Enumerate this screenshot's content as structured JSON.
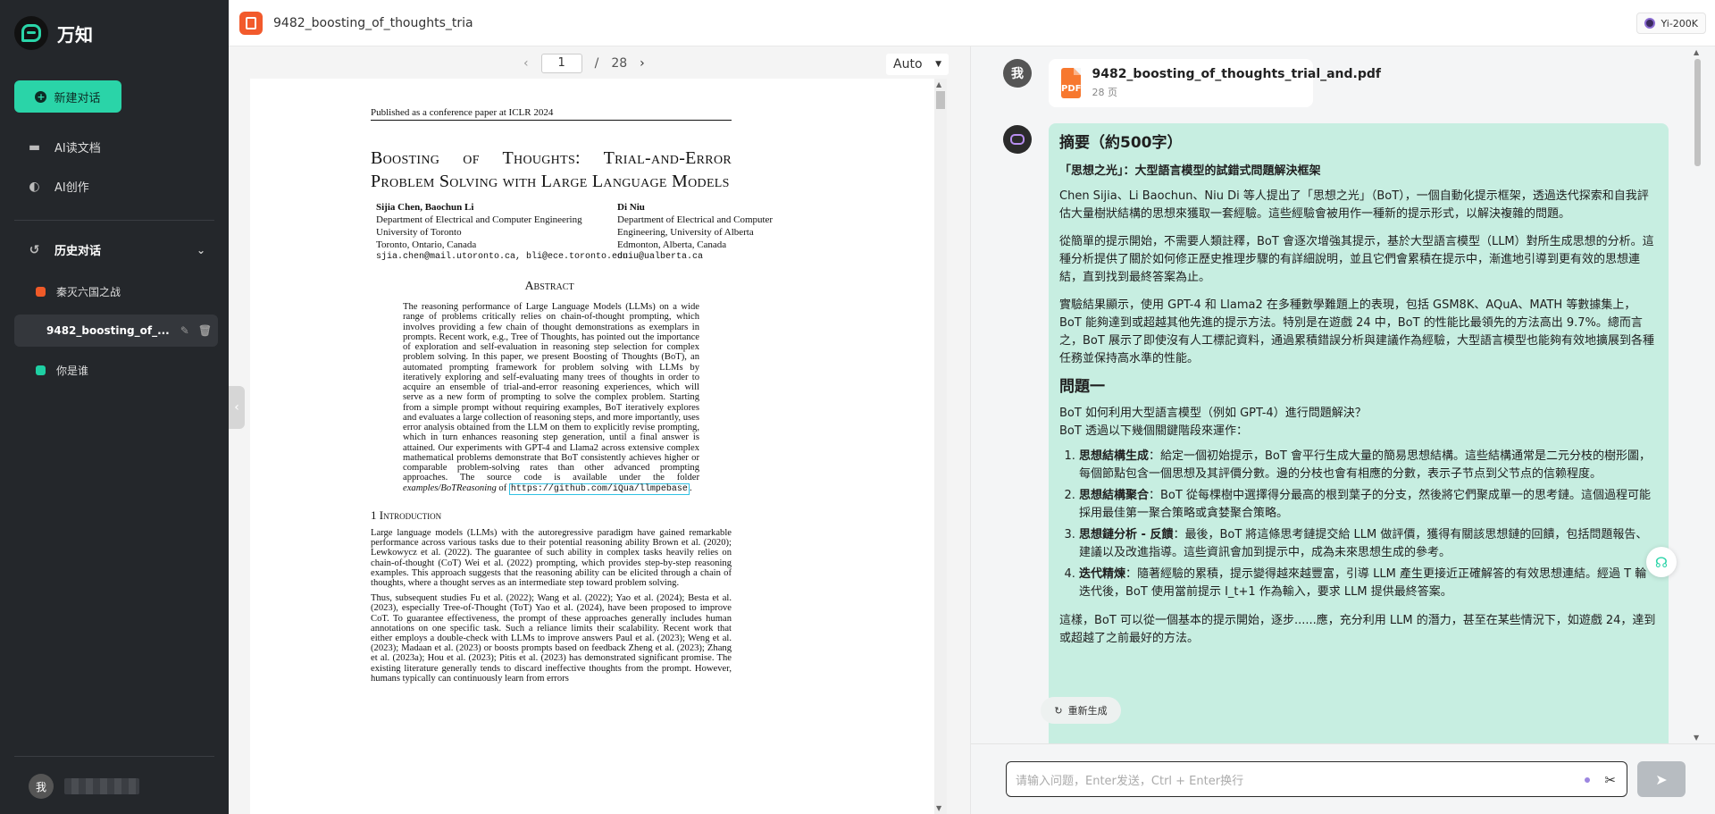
{
  "sidebar": {
    "brand": "万知",
    "new_chat": "新建对话",
    "nav": [
      {
        "label": "AI读文档",
        "icon": "folder-icon"
      },
      {
        "label": "AI创作",
        "icon": "bulb-icon"
      }
    ],
    "history_title": "历史对话",
    "history": [
      {
        "label": "秦灭六国之战",
        "color": "#f05a28"
      },
      {
        "label": "9482_boosting_of_...",
        "color": "#f05a28"
      },
      {
        "label": "你是谁",
        "color": "#1ecfa3"
      }
    ],
    "user_avatar": "我"
  },
  "topbar": {
    "file_title": "9482_boosting_of_thoughts_tria",
    "model": "Yi-200K"
  },
  "viewer": {
    "page": "1",
    "page_sep": "/",
    "total_pages": "28",
    "zoom": "Auto",
    "paper": {
      "conference": "Published as a conference paper at ICLR 2024",
      "title": "Boosting of Thoughts: Trial-and-Error Problem Solving with Large Language Models",
      "authors_left": [
        "Sijia Chen, Baochun Li",
        "Department of Electrical and Computer Engineering",
        "University of Toronto",
        "Toronto, Ontario, Canada",
        "sjia.chen@mail.utoronto.ca, bli@ece.toronto.edu"
      ],
      "authors_right": [
        "Di Niu",
        "Department of Electrical and Computer",
        "Engineering, University of Alberta",
        "Edmonton, Alberta, Canada",
        "dniu@ualberta.ca"
      ],
      "abstract_heading": "Abstract",
      "abstract": "The reasoning performance of Large Language Models (LLMs) on a wide range of problems critically relies on chain-of-thought prompting, which involves providing a few chain of thought demonstrations as exemplars in prompts. Recent work, e.g., Tree of Thoughts, has pointed out the importance of exploration and self-evaluation in reasoning step selection for complex problem solving. In this paper, we present Boosting of Thoughts (BoT), an automated prompting framework for problem solving with LLMs by iteratively exploring and self-evaluating many trees of thoughts in order to acquire an ensemble of trial-and-error reasoning experiences, which will serve as a new form of prompting to solve the complex problem. Starting from a simple prompt without requiring examples, BoT iteratively explores and evaluates a large collection of reasoning steps, and more importantly, uses error analysis obtained from the LLM on them to explicitly revise prompting, which in turn enhances reasoning step generation, until a final answer is attained. Our experiments with GPT-4 and Llama2 across extensive complex mathematical problems demonstrate that BoT consistently achieves higher or comparable problem-solving rates than other advanced prompting approaches. The source code is available under the folder",
      "abstract_folder": "examples/BoTReasoning",
      "abstract_of": "of",
      "abstract_link": "https://github.com/iQua/llmpebase",
      "intro_heading": "1   Introduction",
      "intro_p1": "Large language models (LLMs) with the autoregressive paradigm have gained remarkable performance across various tasks due to their potential reasoning ability Brown et al. (2020); Lewkowycz et al. (2022). The guarantee of such ability in complex tasks heavily relies on chain-of-thought (CoT) Wei et al. (2022) prompting, which provides step-by-step reasoning examples. This approach suggests that the reasoning ability can be elicited through a chain of thoughts, where a thought serves as an intermediate step toward problem solving.",
      "intro_p2": "Thus, subsequent studies Fu et al. (2022); Wang et al. (2022); Yao et al. (2024); Besta et al. (2023), especially Tree-of-Thought (ToT) Yao et al. (2024), have been proposed to improve CoT. To guarantee effectiveness, the prompt of these approaches generally includes human annotations on one specific task. Such a reliance limits their scalability. Recent work that either employs a double-check with LLMs to improve answers Paul et al. (2023); Weng et al. (2023); Madaan et al. (2023) or boosts prompts based on feedback Zheng et al. (2023); Zhang et al. (2023a); Hou et al. (2023); Pitis et al. (2023) has demonstrated significant promise. The existing literature generally tends to discard ineffective thoughts from the prompt. However, humans typically can continuously learn from errors"
    }
  },
  "chat": {
    "me": "我",
    "file_card": {
      "name": "9482_boosting_of_thoughts_trial_and.pdf",
      "pages": "28 页",
      "icon_text": "PDF"
    },
    "answer": {
      "title": "摘要（約500字）",
      "subtitle": "「思想之光」：大型語言模型的試錯式問題解決框架",
      "p1": "Chen Sijia、Li Baochun、Niu Di 等人提出了「思想之光」（BoT），一個自動化提示框架，透過迭代探索和自我評估大量樹狀結構的思想來獲取一套經驗。這些經驗會被用作一種新的提示形式，以解決複雜的問題。",
      "p2": "從簡單的提示開始，不需要人類註釋，BoT 會逐次增強其提示，基於大型語言模型（LLM）對所生成思想的分析。這種分析提供了關於如何修正歷史推理步驟的有詳細說明，並且它們會累積在提示中，漸進地引導到更有效的思想連結，直到找到最終答案為止。",
      "p3": "實驗結果顯示，使用 GPT-4 和 Llama2 在多種數學難題上的表現，包括 GSM8K、AQuA、MATH 等數據集上，BoT 能夠達到或超越其他先進的提示方法。特別是在遊戲 24 中，BoT 的性能比最領先的方法高出 9.7%。總而言之，BoT 展示了即使沒有人工標記資料，通過累積錯誤分析與建議作為經驗，大型語言模型也能夠有效地擴展到各種任務並保持高水準的性能。",
      "q1": "問題一",
      "q1_line1": "BoT 如何利用大型語言模型（例如 GPT-4）進行問題解決？",
      "q1_line2": "BoT 透過以下幾個關鍵階段來運作：",
      "steps": [
        {
          "head": "思想結構生成",
          "text": "：給定一個初始提示，BoT 會平行生成大量的簡易思想結構。這些結構通常是二元分枝的樹形圖，每個節點包含一個思想及其評價分數。邊的分枝也會有相應的分數，表示子节点到父节点的信赖程度。"
        },
        {
          "head": "思想結構聚合",
          "text": "：BoT 從每棵樹中選擇得分最高的根到葉子的分支，然後將它們聚成單一的思考鏈。這個過程可能採用最佳第一聚合策略或貪婪聚合策略。"
        },
        {
          "head": "思想鏈分析 - 反饋",
          "text": "：最後，BoT 將這條思考鏈提交給 LLM 做評價，獲得有關該思想鏈的回饋，包括問題報告、建議以及改進指導。這些資訊會加到提示中，成為未來思想生成的參考。"
        },
        {
          "head": "迭代精煉",
          "text": "：隨著經驗的累積，提示變得越來越豐富，引導 LLM 產生更接近正確解答的有效思想連結。經過 T 輪迭代後，BoT 使用當前提示 I_t+1 作為輸入，要求 LLM 提供最終答案。"
        }
      ],
      "p4": "這樣，BoT 可以從一個基本的提示開始，逐步......應，充分利用 LLM 的潛力，甚至在某些情況下，如遊戲 24，達到或超越了之前最好的方法。"
    },
    "regen": "重新生成",
    "input_placeholder": "请输入问题，Enter发送，Ctrl + Enter换行"
  }
}
